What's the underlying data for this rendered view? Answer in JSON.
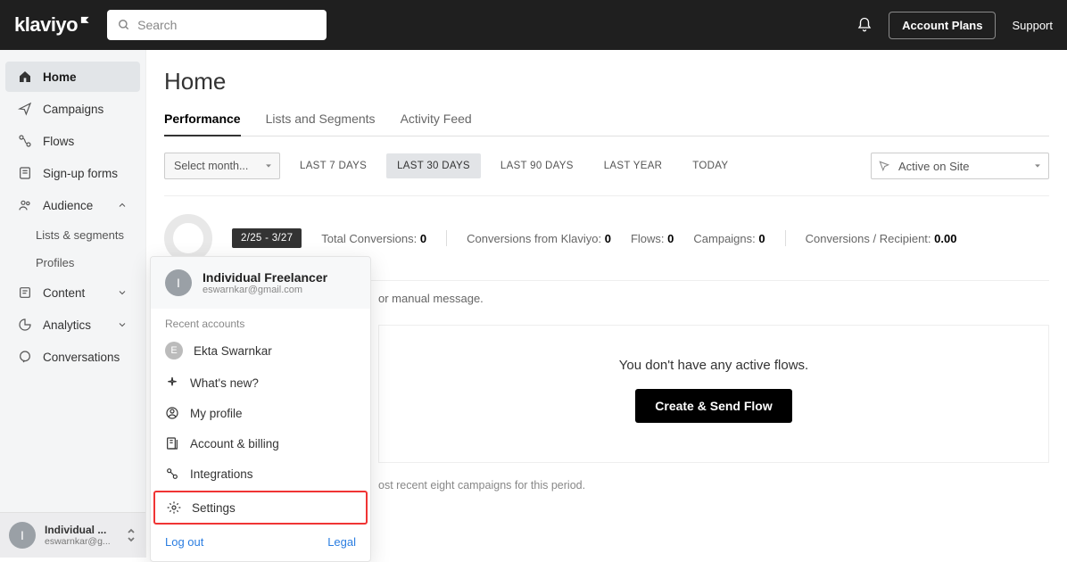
{
  "header": {
    "logo_text": "klaviyo",
    "search_placeholder": "Search",
    "account_plans_label": "Account Plans",
    "support_label": "Support"
  },
  "sidebar": {
    "items": [
      {
        "label": "Home",
        "icon": "home",
        "active": true
      },
      {
        "label": "Campaigns",
        "icon": "send"
      },
      {
        "label": "Flows",
        "icon": "flow"
      },
      {
        "label": "Sign-up forms",
        "icon": "form"
      },
      {
        "label": "Audience",
        "icon": "audience",
        "expanded": true,
        "children": [
          {
            "label": "Lists & segments"
          },
          {
            "label": "Profiles"
          }
        ]
      },
      {
        "label": "Content",
        "icon": "content",
        "chevron": "down"
      },
      {
        "label": "Analytics",
        "icon": "analytics",
        "chevron": "down"
      },
      {
        "label": "Conversations",
        "icon": "chat"
      }
    ],
    "account": {
      "avatar_letter": "I",
      "name": "Individual ...",
      "email": "eswarnkar@g..."
    }
  },
  "main": {
    "page_title": "Home",
    "tabs": [
      {
        "label": "Performance",
        "active": true
      },
      {
        "label": "Lists and Segments"
      },
      {
        "label": "Activity Feed"
      }
    ],
    "select_month_label": "Select month...",
    "ranges": [
      {
        "label": "LAST 7 DAYS"
      },
      {
        "label": "LAST 30 DAYS",
        "active": true
      },
      {
        "label": "LAST 90 DAYS"
      },
      {
        "label": "LAST YEAR"
      },
      {
        "label": "TODAY"
      }
    ],
    "metric_select": "Active on Site",
    "date_pill": "2/25 - 3/27",
    "stats": {
      "total_conversions_label": "Total Conversions:",
      "total_conversions_value": "0",
      "from_klaviyo_label": "Conversions from Klaviyo:",
      "from_klaviyo_value": "0",
      "flows_label": "Flows:",
      "flows_value": "0",
      "campaigns_label": "Campaigns:",
      "campaigns_value": "0",
      "per_recipient_label": "Conversions / Recipient:",
      "per_recipient_value": "0.00"
    },
    "fragment_above": "or manual message.",
    "empty_state_text": "You don't have any active flows.",
    "empty_state_button": "Create & Send Flow",
    "fragment_below": "ost recent eight campaigns for this period."
  },
  "popup": {
    "avatar_letter": "I",
    "name": "Individual Freelancer",
    "email": "eswarnkar@gmail.com",
    "recent_label": "Recent accounts",
    "recent_account_letter": "E",
    "recent_account_name": "Ekta Swarnkar",
    "menu": [
      {
        "label": "What's new?",
        "icon": "sparkle"
      },
      {
        "label": "My profile",
        "icon": "profile"
      },
      {
        "label": "Account & billing",
        "icon": "billing"
      },
      {
        "label": "Integrations",
        "icon": "integrations"
      },
      {
        "label": "Settings",
        "icon": "settings",
        "highlight": true
      }
    ],
    "logout_label": "Log out",
    "legal_label": "Legal"
  }
}
